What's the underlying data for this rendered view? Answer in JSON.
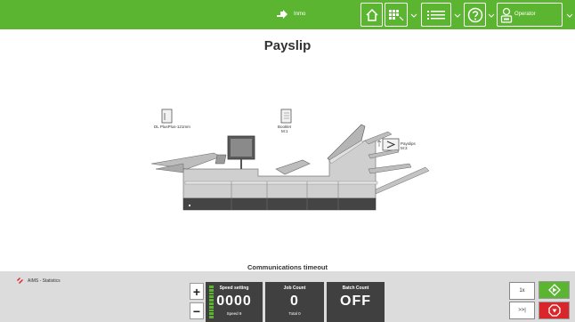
{
  "header": {
    "brand_label": "Inmo",
    "operator_label": "Operator",
    "accent": "#5cb531",
    "icons": [
      "home-icon",
      "job-grid-icon",
      "list-menu-icon",
      "help-icon",
      "operator-icon"
    ]
  },
  "page": {
    "title": "Payslip"
  },
  "machine": {
    "feeder_label": "DL PlusPlus-121mm",
    "booklet_label": "Booklet",
    "booklet_sub": "M:1",
    "payslips_label": "Payslips",
    "payslips_sub": "M:3"
  },
  "status": {
    "message": "Communications timeout"
  },
  "footer": {
    "app_label": "AIMS - Statistics",
    "plus_label": "+",
    "minus_label": "−",
    "speed": {
      "caption": "Speed setting",
      "value": "0000",
      "sub": "Speed 9"
    },
    "job_count": {
      "caption": "Job Count",
      "value": "0",
      "sub": "Total 0"
    },
    "batch_count": {
      "caption": "Batch Count",
      "value": "OFF"
    },
    "one_x_label": "1x",
    "skip_label": ">>|",
    "start_color": "#5cb531",
    "stop_color": "#d9262a"
  }
}
